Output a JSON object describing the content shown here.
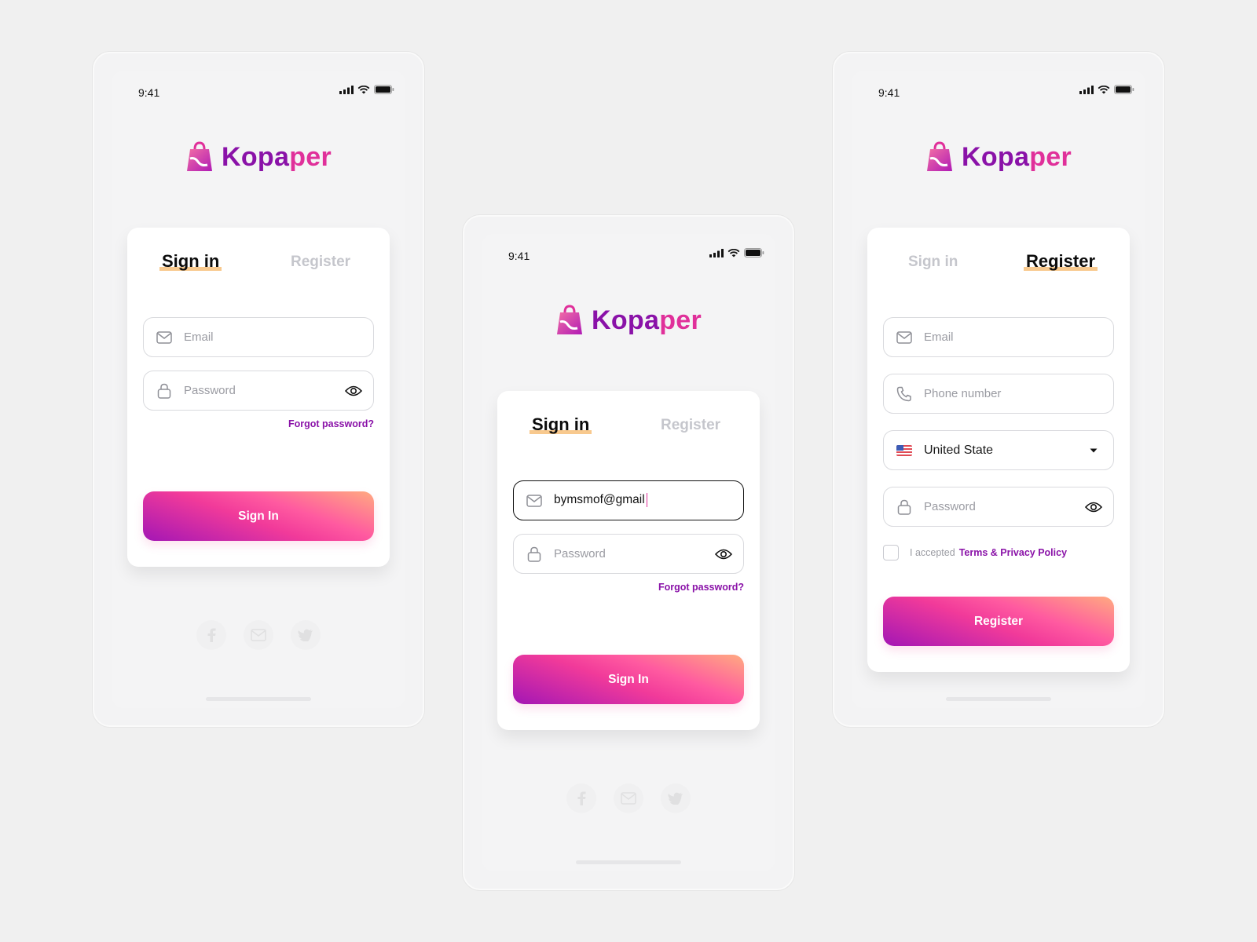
{
  "status_bar": {
    "time": "9:41"
  },
  "brand": {
    "name_part1": "Kopa",
    "name_part2": "per",
    "primary_color": "#8a12a8",
    "accent_color": "#e0309a"
  },
  "screens": {
    "signin_empty": {
      "tabs": {
        "signin": "Sign in",
        "register": "Register"
      },
      "email_placeholder": "Email",
      "password_placeholder": "Password",
      "forgot": "Forgot password?",
      "button": "Sign In"
    },
    "signin_typing": {
      "tabs": {
        "signin": "Sign in",
        "register": "Register"
      },
      "email_value": "bymsmof@gmail",
      "password_placeholder": "Password",
      "forgot": "Forgot password?",
      "button": "Sign In"
    },
    "register": {
      "tabs": {
        "signin": "Sign in",
        "register": "Register"
      },
      "email_placeholder": "Email",
      "phone_placeholder": "Phone number",
      "country": "United State",
      "password_placeholder": "Password",
      "accept_text": "I accepted ",
      "terms_link": "Terms & Privacy Policy",
      "button": "Register"
    }
  },
  "icons": {
    "email": "mail-icon",
    "password": "lock-icon",
    "visibility": "eye-icon",
    "phone": "phone-icon",
    "dropdown": "caret-down-icon",
    "flag": "us-flag-icon",
    "logo": "shopping-bag-icon",
    "social": [
      "facebook-icon",
      "mail-icon",
      "twitter-icon"
    ]
  }
}
